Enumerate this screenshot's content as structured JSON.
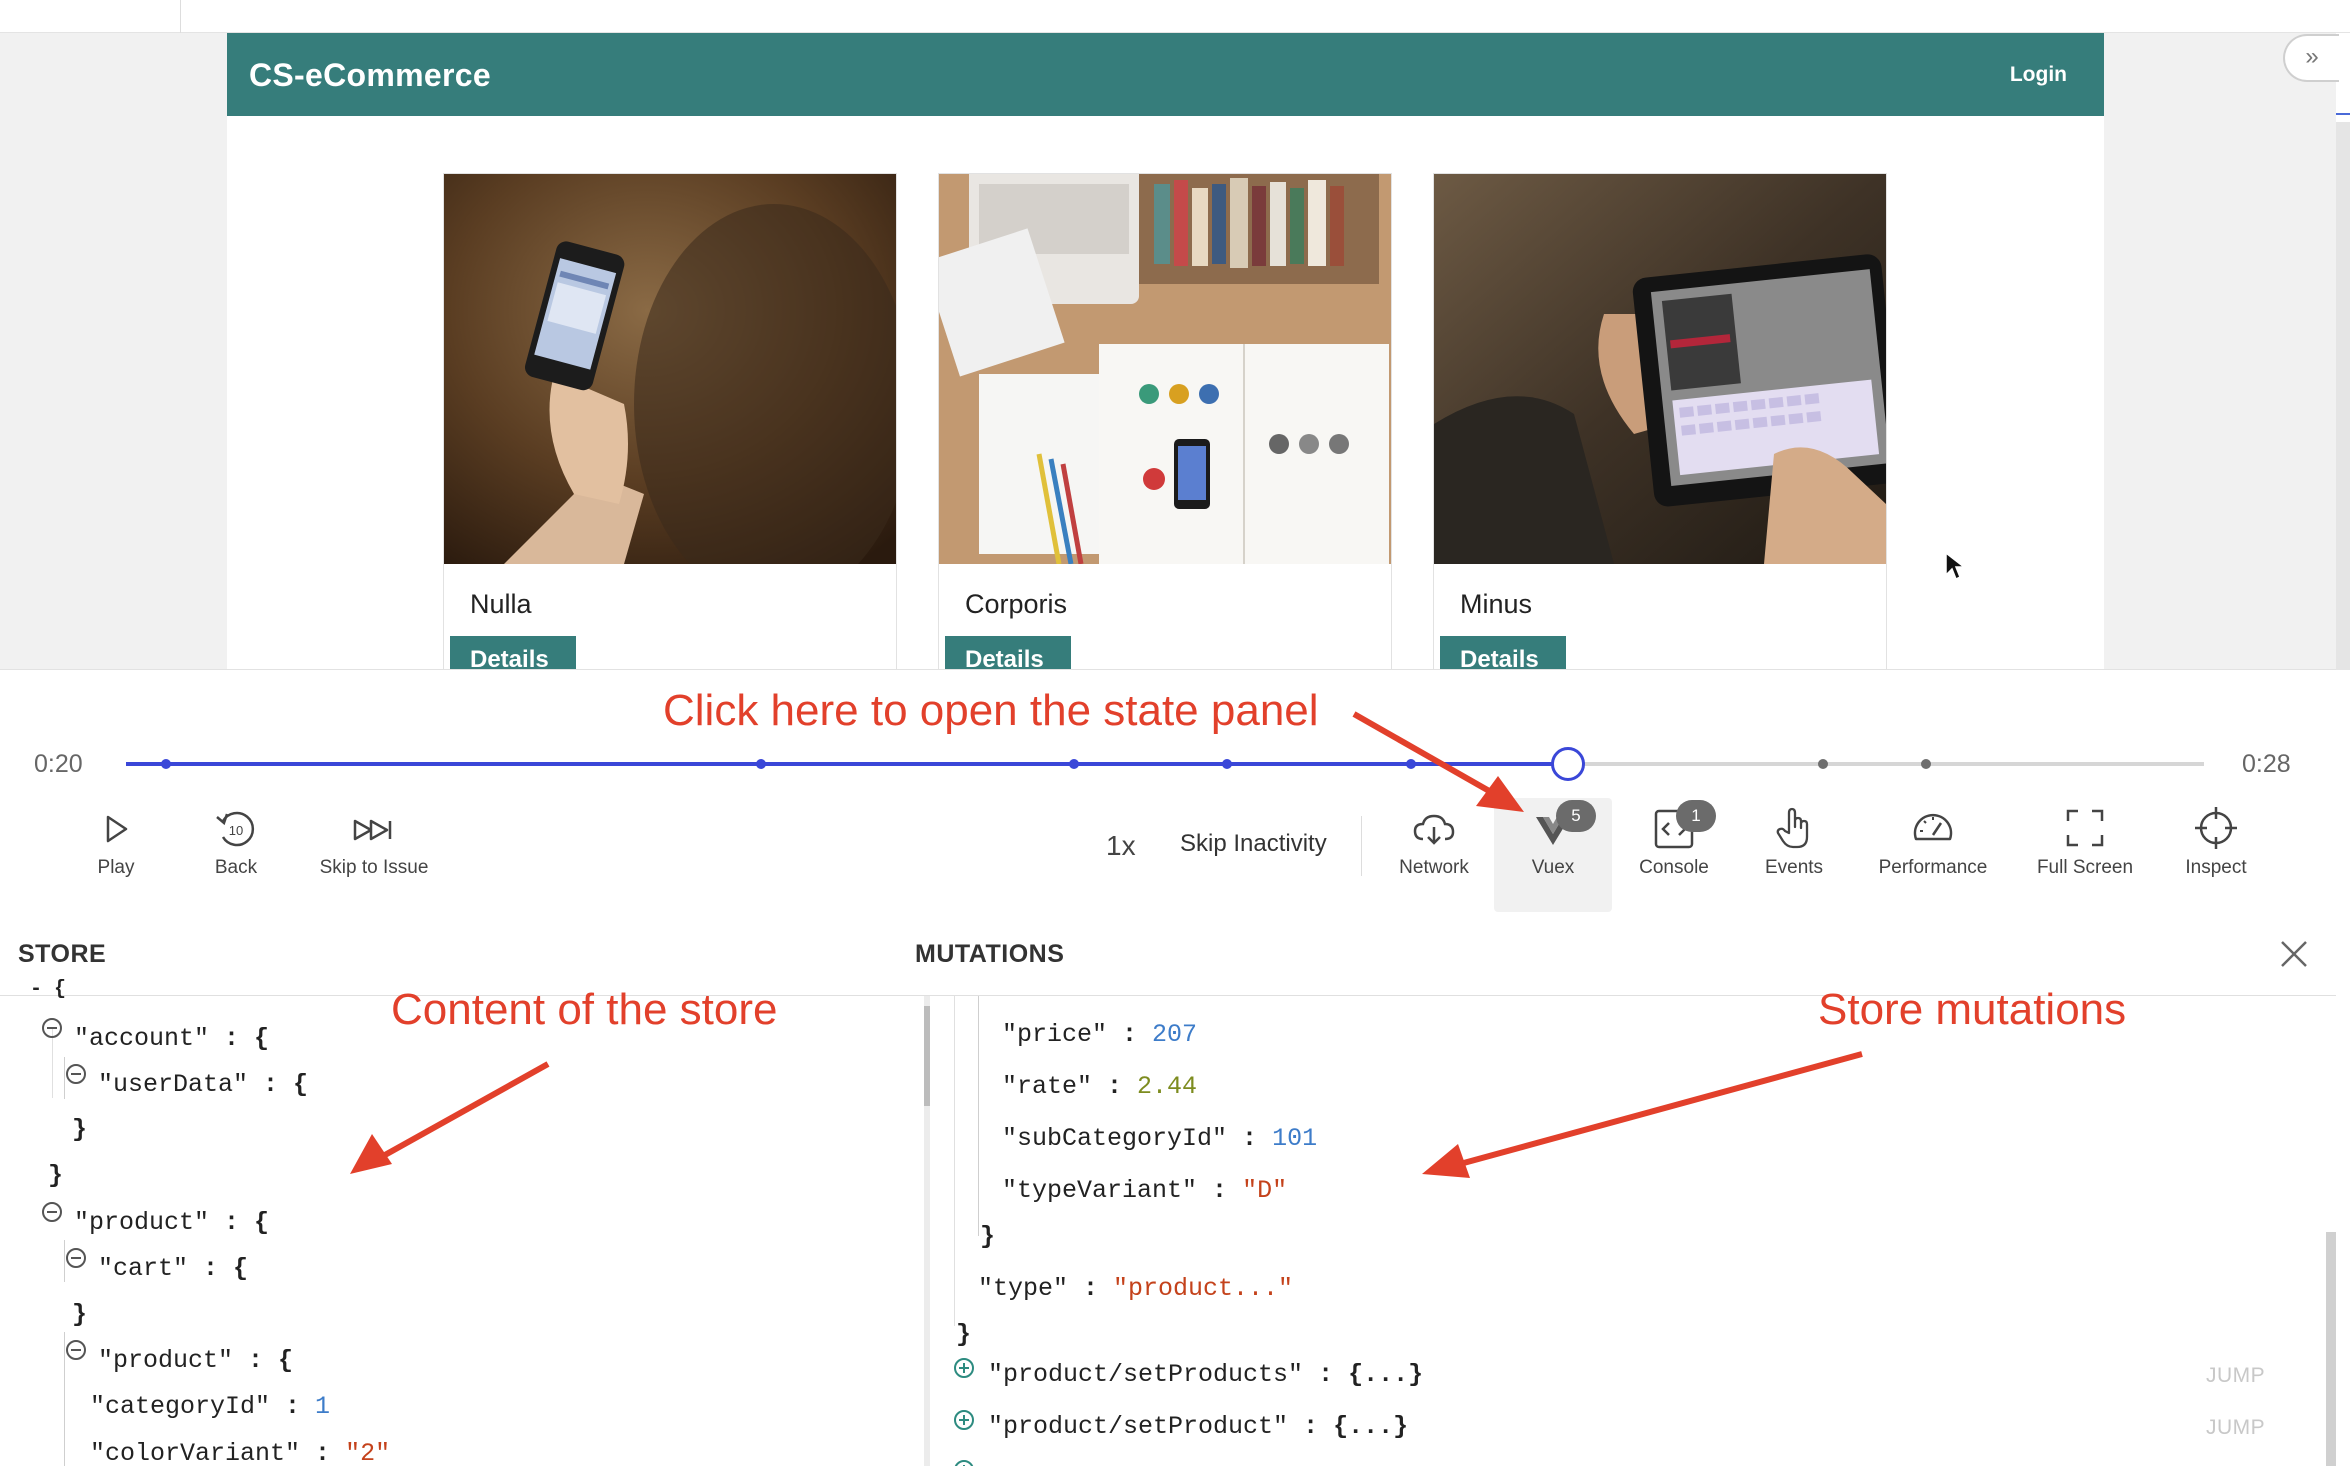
{
  "site": {
    "title": "CS-eCommerce",
    "login_label": "Login",
    "products": [
      {
        "name": "Nulla",
        "button": "Details"
      },
      {
        "name": "Corporis",
        "button": "Details"
      },
      {
        "name": "Minus",
        "button": "Details"
      }
    ]
  },
  "player": {
    "time_current": "0:20",
    "time_total": "0:28",
    "progress": 0.694,
    "speed": "1x",
    "skip_inactivity": "Skip Inactivity",
    "controls": {
      "play": "Play",
      "back": "Back",
      "skip_to_issue": "Skip to Issue",
      "network": "Network",
      "vuex": "Vuex",
      "console": "Console",
      "events": "Events",
      "performance": "Performance",
      "full_screen": "Full Screen",
      "inspect": "Inspect"
    },
    "badges": {
      "vuex": "5",
      "console": "1"
    }
  },
  "panel": {
    "store_title": "STORE",
    "mutations_title": "MUTATIONS",
    "store_lines": {
      "account": "\"account\"",
      "userData": "\"userData\"",
      "product": "\"product\"",
      "cart": "\"cart\"",
      "product_inner": "\"product\"",
      "categoryId_key": "\"categoryId\"",
      "categoryId_val": "1",
      "colorVariant_key": "\"colorVariant\"",
      "colorVariant_val": "\"2\""
    },
    "mutation_lines": {
      "price_key": "\"price\"",
      "price_val": "207",
      "rate_key": "\"rate\"",
      "rate_val": "2.44",
      "subCategoryId_key": "\"subCategoryId\"",
      "subCategoryId_val": "101",
      "typeVariant_key": "\"typeVariant\"",
      "typeVariant_val": "\"D\"",
      "type_key": "\"type\"",
      "type_val": "\"product...\"",
      "setProducts_key": "\"product/setProducts\"",
      "setProduct_key": "\"product/setProduct\"",
      "collapsed": "{...}"
    },
    "jump_label": "JUMP"
  },
  "annotations": {
    "state_panel": "Click here to open the state panel",
    "store_content": "Content of the store",
    "store_mutations": "Store mutations"
  },
  "colors": {
    "header_teal": "#367d7b",
    "annotation_red": "#e2402b",
    "timeline_blue": "#3a47d8",
    "json_number": "#3d7cc9",
    "json_string": "#c4421b"
  }
}
